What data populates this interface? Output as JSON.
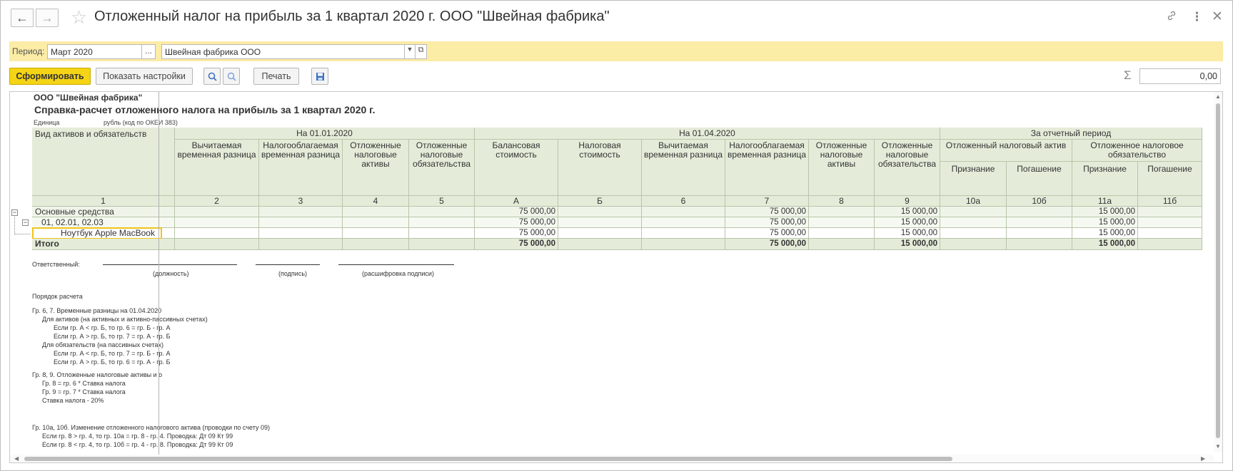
{
  "window": {
    "title": "Отложенный налог на прибыль за 1 квартал 2020 г. ООО \"Швейная фабрика\"",
    "icons": [
      "back-arrow-icon",
      "forward-arrow-icon",
      "star-icon",
      "link-icon",
      "more-vertical-icon",
      "close-icon"
    ]
  },
  "period_bar": {
    "label": "Период:",
    "period_value": "Март 2020",
    "period_button": "...",
    "organization": "Швейная фабрика ООО",
    "accent": "#fbeca6"
  },
  "toolbar": {
    "generate": "Сформировать",
    "settings": "Показать настройки",
    "print": "Печать",
    "sum_value": "0,00"
  },
  "report": {
    "organization": "ООО \"Швейная фабрика\"",
    "title": "Справка-расчет отложенного налога на прибыль за 1 квартал 2020 г.",
    "unit_label": "Единица",
    "unit_value": "рубль (код по ОКЕИ 383)",
    "headers": {
      "col_label": "Вид активов и обязательств",
      "group1": "На 01.01.2020",
      "group2": "На 01.04.2020",
      "group3": "За отчетный период",
      "g1": [
        "Вычитаемая временная разница",
        "Налогооблагаемая временная разница",
        "Отложенные налоговые активы",
        "Отложенные налоговые обязательства"
      ],
      "g2": [
        "Балансовая стоимость",
        "Налоговая стоимость",
        "Вычитаемая временная разница",
        "Налогооблагаемая временная разница",
        "Отложенные налоговые активы",
        "Отложенные налоговые обязательства"
      ],
      "g3_sub1": "Отложенный налоговый актив",
      "g3_sub2": "Отложенное налоговое обязательство",
      "g3_cols": [
        "Признание",
        "Погашение",
        "Признание",
        "Погашение"
      ]
    },
    "col_numbers": [
      "1",
      "2",
      "3",
      "4",
      "5",
      "А",
      "Б",
      "6",
      "7",
      "8",
      "9",
      "10а",
      "10б",
      "11а",
      "11б"
    ],
    "rows": [
      {
        "label": "Основные средства",
        "A": "75 000,00",
        "c7": "75 000,00",
        "c9": "15 000,00",
        "c11a": "15 000,00"
      },
      {
        "label": "01, 02.01, 02.03",
        "A": "75 000,00",
        "c7": "75 000,00",
        "c9": "15 000,00",
        "c11a": "15 000,00"
      },
      {
        "label": "Ноутбук Apple MacBook",
        "A": "75 000,00",
        "c7": "75 000,00",
        "c9": "15 000,00",
        "c11a": "15 000,00"
      }
    ],
    "total": {
      "label": "Итого",
      "A": "75 000,00",
      "c7": "75 000,00",
      "c9": "15 000,00",
      "c11a": "15 000,00"
    },
    "signature": {
      "responsible": "Ответственный:",
      "position": "(должность)",
      "signature": "(подпись)",
      "decoding": "(расшифровка подписи)"
    },
    "notes": [
      "Порядок расчета",
      "Гр. 6, 7. Временные разницы на 01.04.2020",
      "Для активов (на активных и активно-пассивных счетах)",
      "Если гр. А < гр. Б, то гр. 6 = гр. Б - гр. А",
      "Если гр. А > гр. Б, то гр. 7 = гр. А - гр. Б",
      "Для обязательств (на пассивных счетах)",
      "Если гр. А < гр. Б, то гр. 7 = гр. Б - гр. А",
      "Если гр. А > гр. Б, то гр. 6 = гр. А - гр. Б",
      "Гр. 8, 9. Отложенные налоговые активы и о",
      "Гр. 8 = гр. 6 * Ставка налога",
      "Гр. 9 = гр. 7 * Ставка налога",
      "Ставка налога - 20%",
      "Гр. 10а, 10б. Изменение отложенного налогового актива (проводки по счету 09)",
      "Если гр. 8 > гр. 4, то гр. 10а = гр. 8 - гр. 4. Проводка: Дт 09 Кт 99",
      "Если гр. 8 < гр. 4, то гр. 10б = гр. 4 - гр. 8. Проводка: Дт 99 Кт 09"
    ]
  }
}
